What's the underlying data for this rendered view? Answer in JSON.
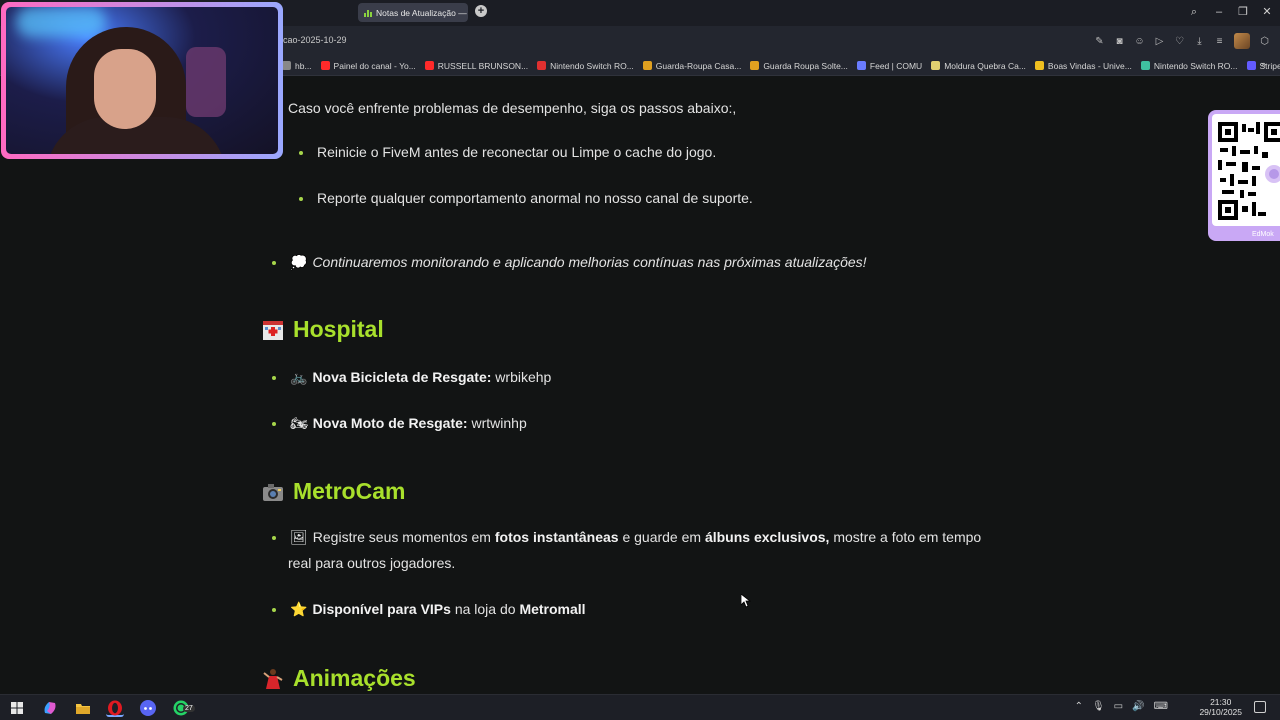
{
  "browser": {
    "tab_title": "Notas de Atualização — ...",
    "address_text": "cao-2025-10-29",
    "bookmarks": [
      {
        "label": "hb...",
        "color": "#888888"
      },
      {
        "label": "Painel do canal - Yo...",
        "color": "#ff2a2a"
      },
      {
        "label": "RUSSELL BRUNSON...",
        "color": "#ff2a2a"
      },
      {
        "label": "Nintendo Switch RO...",
        "color": "#e03030"
      },
      {
        "label": "Guarda-Roupa Casa...",
        "color": "#e0a020"
      },
      {
        "label": "Guarda Roupa Solte...",
        "color": "#e0a020"
      },
      {
        "label": "Feed | COMU",
        "color": "#6a7cff"
      },
      {
        "label": "Moldura Quebra Ca...",
        "color": "#e0d070"
      },
      {
        "label": "Boas Vindas - Unive...",
        "color": "#f0c020"
      },
      {
        "label": "Nintendo Switch RO...",
        "color": "#3fbf9f"
      },
      {
        "label": "Stripe Express",
        "color": "#635bff"
      }
    ],
    "bookmarks_more": "»"
  },
  "overlays": {
    "qr_label": "EdMok"
  },
  "article": {
    "intro": "Caso você enfrente problemas de desempenho, siga os passos abaixo:,",
    "sub_items": [
      "Reinicie o FiveM antes de reconectar ou Limpe o cache do jogo.",
      "Reporte qualquer comportamento anormal no nosso canal de suporte."
    ],
    "monitor_emoji": "💭",
    "monitor_text": "Continuaremos monitorando e aplicando melhorias contínuas nas próximas atualizações!",
    "sections": {
      "hospital": {
        "title": "Hospital",
        "items": [
          {
            "emoji": "🚲",
            "bold": "Nova Bicicleta de Resgate:",
            "text": " wrbikehp"
          },
          {
            "emoji": "🏍",
            "bold": "Nova Moto de Resgate:",
            "text": " wrtwinhp"
          }
        ]
      },
      "metrocam": {
        "title": "MetroCam",
        "item1_emoji": "🖼",
        "item1_part1": "Registre seus momentos em ",
        "item1_bold1": "fotos instantâneas",
        "item1_part2": " e guarde em ",
        "item1_bold2": "álbuns exclusivos,",
        "item1_part3": " mostre a foto em tempo",
        "item1_line2": "real para outros jogadores.",
        "item2_emoji": "⭐",
        "item2_bold1": "Disponível para VIPs",
        "item2_part": " na loja do ",
        "item2_bold2": "Metromall"
      },
      "animacoes": {
        "title": "Animações"
      }
    }
  },
  "taskbar": {
    "whatsapp_badge": "27",
    "time": "21:30",
    "date": "29/10/2025"
  }
}
